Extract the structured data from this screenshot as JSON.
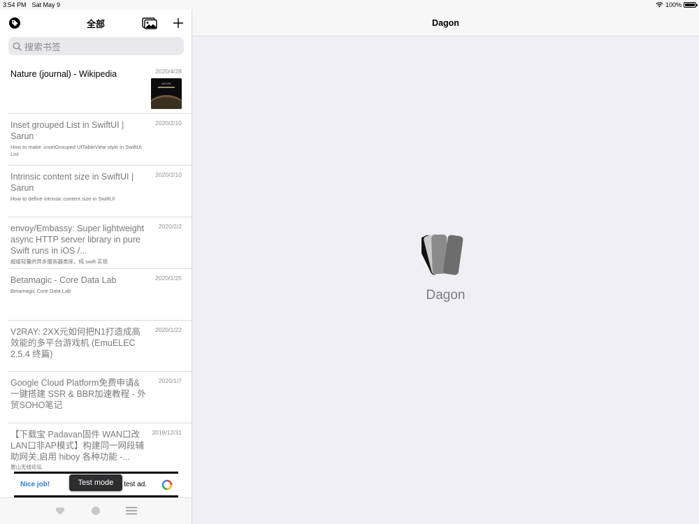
{
  "status": {
    "time": "3:54 PM",
    "date": "Sat May 9",
    "battery": "100%"
  },
  "sidebar": {
    "title": "全部",
    "search_placeholder": "搜索书签",
    "bookmarks": [
      {
        "title": "Nature (journal) - Wikipedia",
        "date": "2020/4/28",
        "desc": "",
        "has_thumbnail": true
      },
      {
        "title": "Inset grouped List in SwiftUI | Sarun",
        "date": "2020/2/10",
        "desc": "How to make .insetGrouped UITableView style in SwiftUI List"
      },
      {
        "title": "Intrinsic content size in SwiftUI | Sarun",
        "date": "2020/2/10",
        "desc": "How to define intrinsic content size in SwiftUI"
      },
      {
        "title": "envoy/Embassy: Super lightweight async HTTP server library in pure Swift runs in iOS /...",
        "date": "2020/2/2",
        "desc": "超级轻量的异步服务器类库，纯 swift 实现"
      },
      {
        "title": "Betamagic - Core Data Lab",
        "date": "2020/1/25",
        "desc": "Betamagic Core Data Lab"
      },
      {
        "title": "V2RAY: 2XX元如何把N1打造成高效能的多平台游戏机 (EmuELEC 2.5.4 终篇)",
        "date": "2020/1/22",
        "desc": ""
      },
      {
        "title": "Google Cloud Platform免费申请& 一键搭建 SSR & BBR加速教程 - 外贸SOHO笔记",
        "date": "2020/1/7",
        "desc": ""
      },
      {
        "title": "【下载宝 Padavan固件 WAN口改LAN口非AP模式】构建同一网段辅助网关,启用 hiboy 各种功能 -...",
        "date": "2019/12/31",
        "desc": "恩山无线论坛"
      }
    ],
    "ad": {
      "left_text": "Nice job!",
      "right_text": "test ad.",
      "test_mode_label": "Test mode"
    }
  },
  "detail": {
    "nav_title": "Dagon",
    "app_name": "Dagon"
  },
  "icons": {
    "tag": "tag-icon",
    "gallery": "gallery-icon",
    "add": "plus-icon",
    "search": "search-icon",
    "tabs": [
      "heart-icon",
      "circle-icon",
      "menu-icon"
    ]
  },
  "colors": {
    "ad_accent": "#2e7bd6",
    "separator": "#dcdcdf",
    "detail_bg": "#efeff4"
  }
}
